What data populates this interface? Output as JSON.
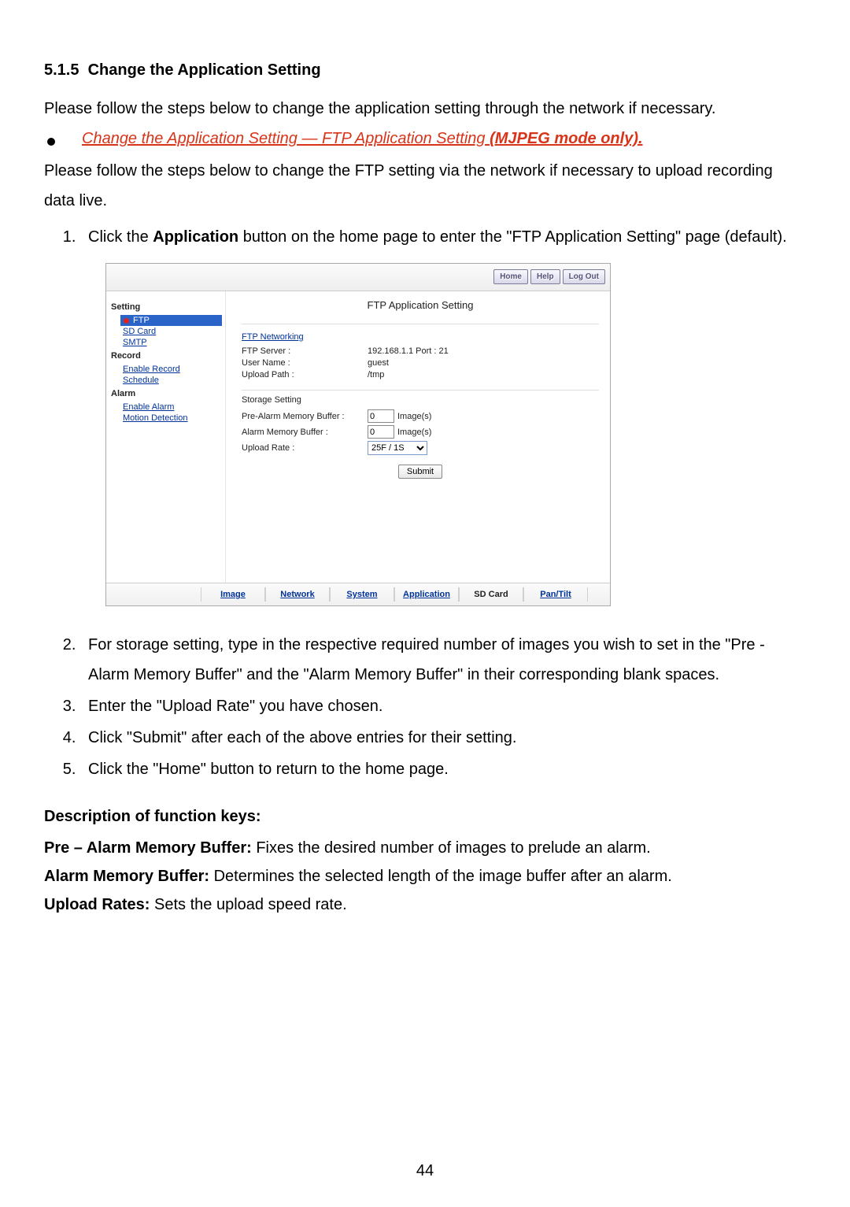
{
  "doc": {
    "section_heading_num": "5.1.5",
    "section_heading_text": "Change the Application Setting",
    "intro": "Please follow the steps below to change the application setting through the network if necessary.",
    "sub_bullet_prefix": "Change the Application Setting — FTP Application Setting ",
    "sub_bullet_bold": "(MJPEG mode only).",
    "sub_intro": "Please follow the steps below to change the FTP setting via the network if necessary to upload recording data live.",
    "step1_a": "Click the ",
    "step1_app": "Application",
    "step1_b": " button on the home page to enter the \"FTP Application Setting\" page (default).",
    "step2": "For storage setting, type in the respective required number of images you wish to set in the \"Pre - Alarm Memory Buffer\" and the \"Alarm Memory Buffer\" in their corresponding blank spaces.",
    "step3": "Enter the \"Upload Rate\" you have chosen.",
    "step4": "Click \"Submit\" after each of the above entries for their setting.",
    "step5": "Click the \"Home\" button to return to the home page.",
    "func_head": "Description of function keys:",
    "def1_term": "Pre – Alarm Memory Buffer:",
    "def1_text": " Fixes the desired number of images to prelude an alarm.",
    "def2_term": "Alarm Memory Buffer:",
    "def2_text": " Determines the selected length of the image buffer after an alarm.",
    "def3_term": "Upload Rates:",
    "def3_text": " Sets the upload speed rate.",
    "page_number": "44"
  },
  "ui": {
    "top_buttons": {
      "home": "Home",
      "help": "Help",
      "logout": "Log Out"
    },
    "sidebar": {
      "group_setting": "Setting",
      "ftp": "FTP",
      "sdcard": "SD Card",
      "smtp": "SMTP",
      "group_record": "Record",
      "enable_record": "Enable Record",
      "schedule": "Schedule",
      "group_alarm": "Alarm",
      "enable_alarm": "Enable Alarm",
      "motion": "Motion Detection"
    },
    "content": {
      "title": "FTP Application Setting",
      "net_head": "FTP Networking",
      "ftp_server_label": "FTP Server :",
      "ftp_server_value": "192.168.1.1  Port : 21",
      "user_label": "User Name :",
      "user_value": "guest",
      "path_label": "Upload Path :",
      "path_value": "/tmp",
      "storage_head": "Storage Setting",
      "prealarm_label": "Pre-Alarm Memory Buffer :",
      "prealarm_value": "0",
      "alarm_label": "Alarm Memory Buffer :",
      "alarm_value": "0",
      "images_unit": "Image(s)",
      "uploadrate_label": "Upload Rate :",
      "uploadrate_value": "25F / 1S",
      "submit": "Submit"
    },
    "bottomnav": {
      "image": "Image",
      "network": "Network",
      "system": "System",
      "application": "Application",
      "sdcard": "SD Card",
      "pantilt": "Pan/Tilt"
    }
  }
}
